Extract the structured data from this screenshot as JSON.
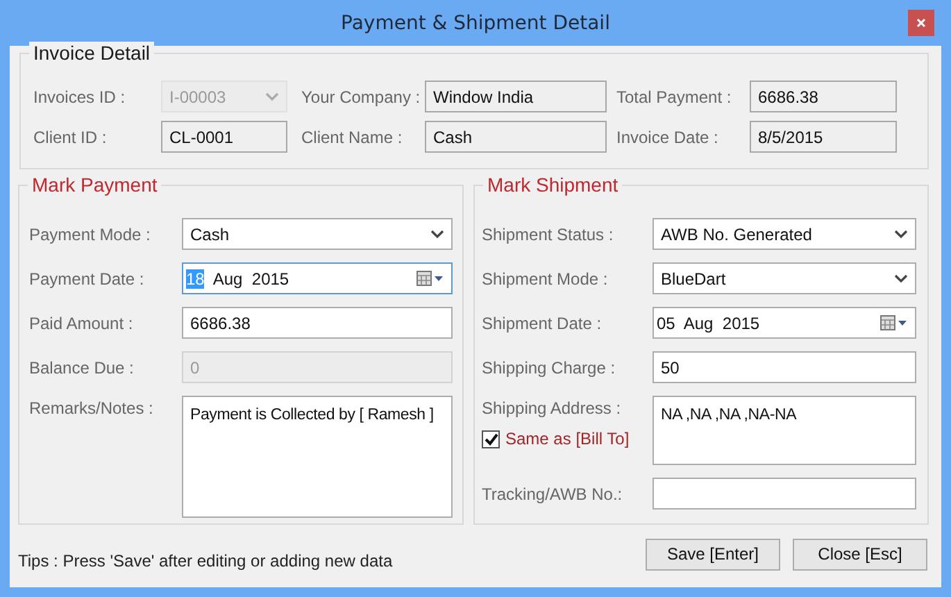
{
  "window": {
    "title": "Payment & Shipment Detail"
  },
  "invoice_detail": {
    "title": "Invoice Detail",
    "fields": [
      {
        "label": "Invoices ID :",
        "value": "I-00003",
        "kind": "combo",
        "disabled": true
      },
      {
        "label": "Your Company :",
        "value": "Window India",
        "kind": "readonly",
        "disabled": false
      },
      {
        "label": "Total Payment :",
        "value": "6686.38",
        "kind": "readonly",
        "disabled": false
      },
      {
        "label": "Client ID :",
        "value": "CL-0001",
        "kind": "readonly",
        "disabled": false
      },
      {
        "label": "Client Name :",
        "value": "Cash",
        "kind": "readonly",
        "disabled": false
      },
      {
        "label": "Invoice Date :",
        "value": "8/5/2015",
        "kind": "readonly",
        "disabled": false
      }
    ]
  },
  "mark_payment": {
    "title": "Mark Payment",
    "fields": [
      {
        "label": "Payment Mode :",
        "kind": "combo",
        "value": "Cash",
        "disabled": false
      },
      {
        "label": "Payment Date :",
        "kind": "date",
        "day": "18",
        "month": "Aug",
        "year": "2015",
        "day_selected": true,
        "focused": true
      },
      {
        "label": "Paid Amount :",
        "kind": "text",
        "value": "6686.38",
        "disabled": false
      },
      {
        "label": "Balance Due :",
        "kind": "text",
        "value": "0",
        "disabled": true
      },
      {
        "label": "Remarks/Notes :",
        "kind": "textarea",
        "value": "Payment is Collected by [ Ramesh ]"
      }
    ]
  },
  "mark_shipment": {
    "title": "Mark Shipment",
    "fields": [
      {
        "label": "Shipment Status :",
        "kind": "combo",
        "value": "AWB No. Generated",
        "disabled": false
      },
      {
        "label": "Shipment Mode :",
        "kind": "combo",
        "value": "BlueDart",
        "disabled": false
      },
      {
        "label": "Shipment Date :",
        "kind": "date",
        "day": "05",
        "month": "Aug",
        "year": "2015",
        "day_selected": false,
        "focused": false
      },
      {
        "label": "Shipping Charge :",
        "kind": "text",
        "value": "50",
        "disabled": false
      },
      {
        "label": "Shipping Address :",
        "kind": "textarea",
        "value": "NA ,NA ,NA ,NA-NA",
        "checkbox": {
          "label": "Same as [Bill To]",
          "checked": true
        }
      },
      {
        "label": "Tracking/AWB No.:",
        "kind": "text",
        "disabled": false
      }
    ]
  },
  "tips": "Tips : Press 'Save' after editing or adding new data",
  "buttons": [
    {
      "label": "Save [Enter]"
    },
    {
      "label": "Close [Esc]"
    }
  ]
}
